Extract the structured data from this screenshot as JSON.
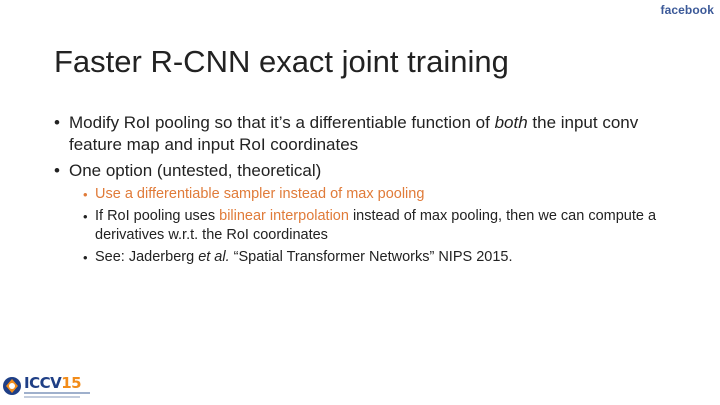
{
  "brand": "facebook",
  "title": "Faster R-CNN exact joint training",
  "bullets": [
    {
      "text": "Modify RoI pooling so that it’s a differentiable function of ",
      "emphasis": "both",
      "text_after": " the input conv feature map and input RoI coordinates"
    },
    {
      "text": "One option (untested, theoretical)",
      "subbullets": [
        {
          "text": "Use a differentiable sampler instead of max pooling"
        },
        {
          "text_before": "If RoI pooling uses ",
          "highlight": "bilinear interpolation",
          "text_after": " instead of max pooling, then we can compute a derivatives w.r.t. the RoI coordinates"
        },
        {
          "text_before": "See: Jaderberg ",
          "emphasis": "et al.",
          "text_after": " “Spatial Transformer Networks” NIPS 2015."
        }
      ]
    }
  ],
  "bullet_glyph": "•",
  "logo": {
    "text_main": "ICCV",
    "text_num": "15",
    "icon": "iccv-logo-icon"
  },
  "colors": {
    "accent": "#e07b39",
    "brand": "#3b5998",
    "text": "#222222"
  }
}
